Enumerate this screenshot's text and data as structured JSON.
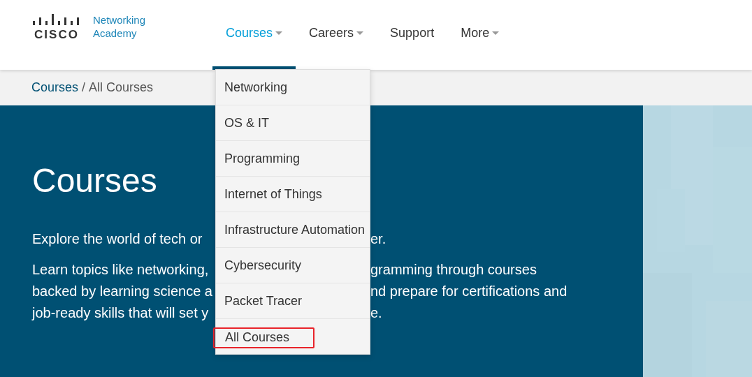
{
  "logo": {
    "wordmark": "CISCO",
    "product": [
      "Networking",
      "Academy"
    ]
  },
  "nav": [
    {
      "label": "Courses",
      "selected": true,
      "has_caret": true
    },
    {
      "label": "Careers",
      "selected": false,
      "has_caret": true
    },
    {
      "label": "Support",
      "selected": false,
      "has_caret": false
    },
    {
      "label": "More",
      "selected": false,
      "has_caret": true
    }
  ],
  "breadcrumb": {
    "link": "Courses",
    "separator": "/",
    "current": "All Courses"
  },
  "hero": {
    "title": "Courses",
    "paragraphs": [
      [
        {
          "left": "Explore the world of tech or",
          "right": "er."
        }
      ],
      [
        {
          "left": "Learn topics like networking,",
          "right": "gramming through courses"
        },
        {
          "left": "backed by learning science a",
          "right": "nd prepare for certifications and"
        },
        {
          "left": "job-ready skills that will set y",
          "right": "e."
        }
      ]
    ],
    "side_image": {
      "kind": "picture"
    }
  },
  "dropdown": [
    {
      "label": "Networking",
      "highlighted": false
    },
    {
      "label": "OS & IT",
      "highlighted": false
    },
    {
      "label": "Programming",
      "highlighted": false
    },
    {
      "label": "Internet of Things",
      "highlighted": false
    },
    {
      "label": "Infrastructure Automation",
      "highlighted": false
    },
    {
      "label": "Cybersecurity",
      "highlighted": false
    },
    {
      "label": "Packet Tracer",
      "highlighted": false
    },
    {
      "label": "All Courses",
      "highlighted": true
    }
  ]
}
